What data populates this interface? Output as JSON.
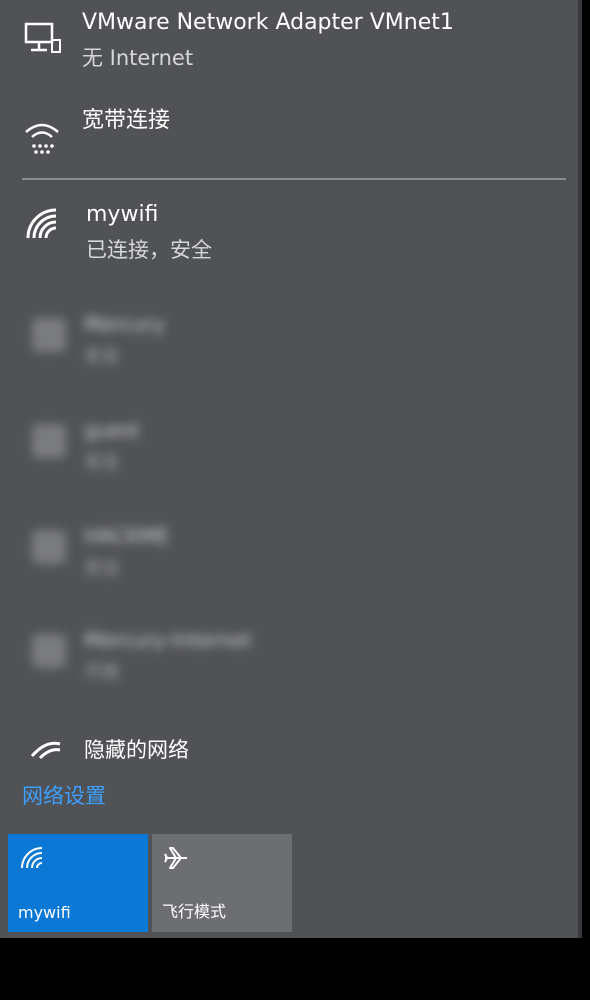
{
  "networks": {
    "vmnet": {
      "name": "VMware Network Adapter VMnet1",
      "status": "无 Internet",
      "icon": "monitor-network-icon"
    },
    "broadband": {
      "name": "宽带连接",
      "icon": "dialup-icon"
    },
    "mywifi": {
      "name": "mywifi",
      "status": "已连接，安全",
      "icon": "wifi-icon"
    }
  },
  "blurred_networks": [
    {
      "name": "Mercury",
      "status": "安全"
    },
    {
      "name": "guest",
      "status": "安全"
    },
    {
      "name": "HACKME",
      "status": "安全"
    },
    {
      "name": "Mercury-Internet",
      "status": "开放"
    }
  ],
  "hidden_network": {
    "label": "隐藏的网络",
    "icon": "wifi-hidden-icon"
  },
  "settings_link": "网络设置",
  "quick_actions": {
    "wifi_tile": {
      "label": "mywifi",
      "icon": "wifi-icon",
      "active": true,
      "color": "#0a78d4"
    },
    "airplane_tile": {
      "label": "飞行模式",
      "icon": "airplane-icon",
      "active": false
    }
  },
  "colors": {
    "panel_bg": "#505256",
    "accent": "#0a78d4",
    "link": "#3ba0ff"
  }
}
